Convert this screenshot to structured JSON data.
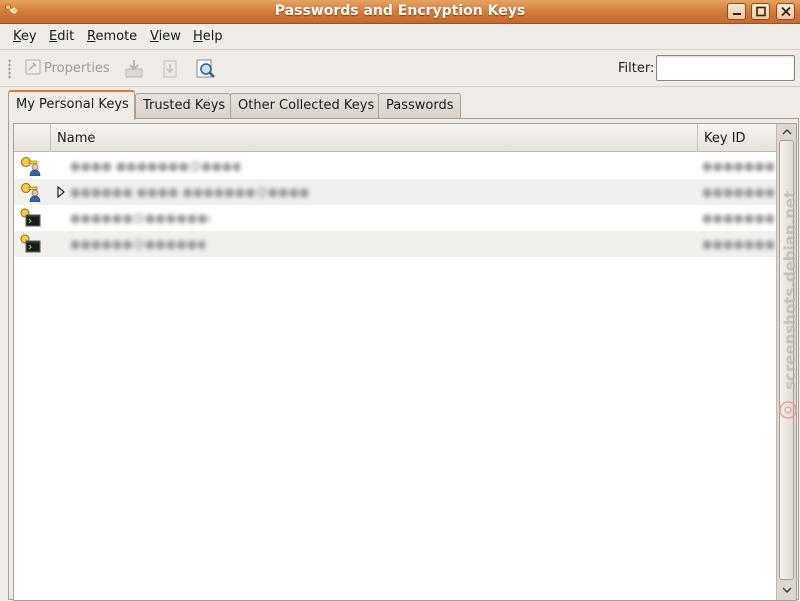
{
  "window": {
    "title": "Passwords and Encryption Keys"
  },
  "menu": {
    "items": [
      "Key",
      "Edit",
      "Remote",
      "View",
      "Help"
    ]
  },
  "toolbar": {
    "properties_label": "Properties",
    "filter_label": "Filter:",
    "filter_value": ""
  },
  "tabs": [
    {
      "label": "My Personal Keys",
      "active": true
    },
    {
      "label": "Trusted Keys",
      "active": false
    },
    {
      "label": "Other Collected Keys",
      "active": false
    },
    {
      "label": "Passwords",
      "active": false
    }
  ],
  "table": {
    "columns": [
      "Name",
      "Key ID"
    ],
    "rows": [
      {
        "icon": "personal-key-icon",
        "expandable": false,
        "name": "●●●● ●●●●●●●@●●●●.●●●",
        "key_id": "●●●●●●●●"
      },
      {
        "icon": "personal-key-icon",
        "expandable": true,
        "name": "●●●●●● ●●●● ●●●●●●●@●●●●●●●.●●●",
        "key_id": "●●●●●●●●"
      },
      {
        "icon": "ssh-key-icon",
        "expandable": false,
        "name": "●●●●●●@●●●●●●●●●",
        "key_id": "●●●●●●●●"
      },
      {
        "icon": "ssh-key-icon",
        "expandable": false,
        "name": "●●●●●●@●●●●●●●",
        "key_id": "●●●●●●●●"
      }
    ]
  },
  "colors": {
    "titlebar": "#d0793a",
    "active_tab_accent": "#d27c3e"
  },
  "watermark": "screenshots.debian.net"
}
